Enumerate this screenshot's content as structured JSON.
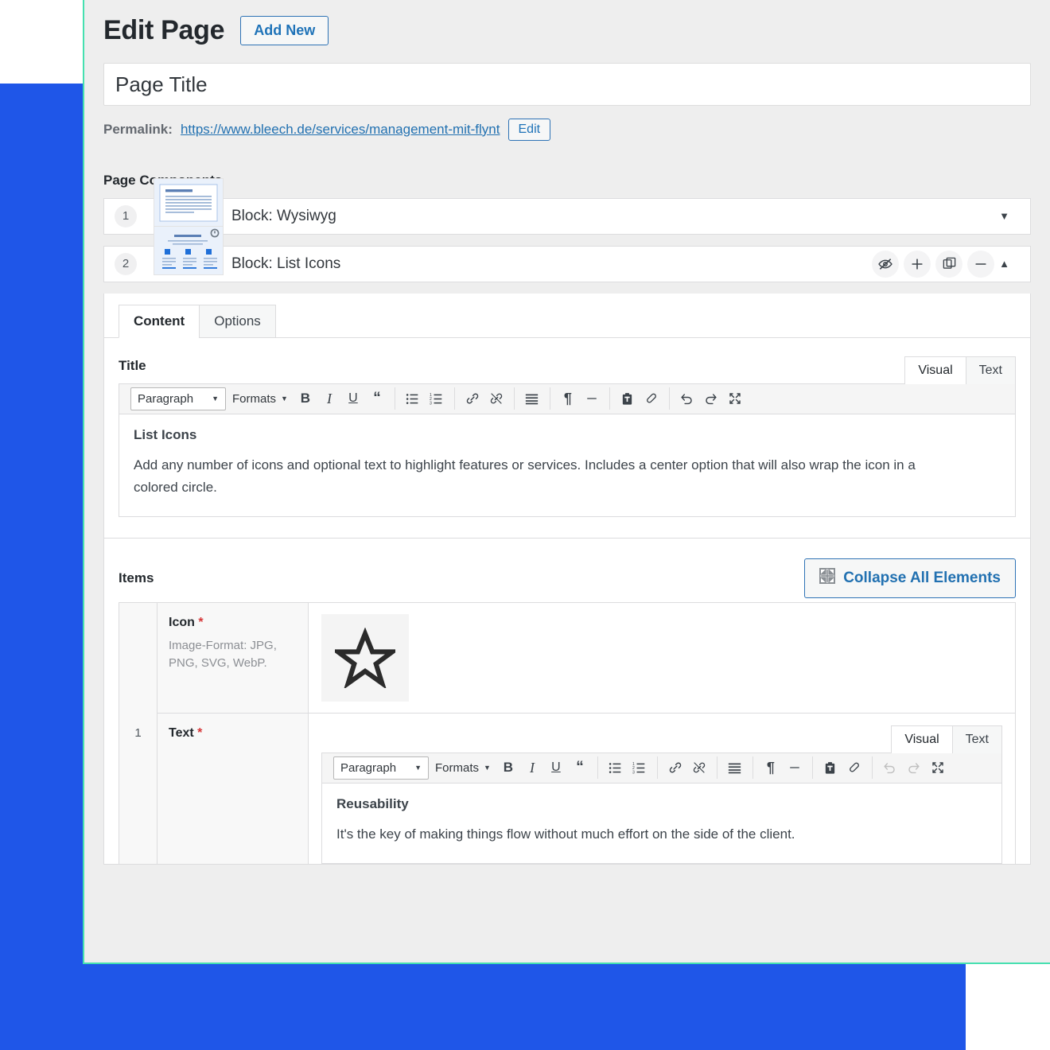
{
  "colors": {
    "accent_blue": "#1f56e8",
    "frame_border_teal": "#45e0b0",
    "link_blue": "#2271b1",
    "required_red": "#d63638"
  },
  "header": {
    "title": "Edit Page",
    "add_new_label": "Add New"
  },
  "title_field": {
    "value": "Page Title"
  },
  "permalink": {
    "label": "Permalink:",
    "url": "https://www.bleech.de/services/management-mit-flynt",
    "edit_label": "Edit"
  },
  "components": {
    "heading": "Page Components",
    "blocks": [
      {
        "number": "1",
        "label": "Block: Wysiwyg",
        "thumb": "wysiwyg-thumbnail",
        "expanded": false,
        "caret": "▼"
      },
      {
        "number": "2",
        "label": "Block: List Icons",
        "thumb": "list-icons-thumbnail",
        "expanded": true,
        "caret": "▲",
        "actions": [
          "hide-eye-icon",
          "add-icon",
          "duplicate-icon",
          "remove-icon",
          "collapse-caret-icon"
        ]
      }
    ]
  },
  "block_panel": {
    "tabs": [
      {
        "label": "Content",
        "active": true
      },
      {
        "label": "Options",
        "active": false
      }
    ],
    "title_field": {
      "label": "Title",
      "editor_modes": [
        {
          "label": "Visual",
          "active": true
        },
        {
          "label": "Text",
          "active": false
        }
      ],
      "toolbar": {
        "format_select": "Paragraph",
        "formats_label": "Formats",
        "buttons": [
          "bold-icon",
          "italic-icon",
          "underline-icon",
          "blockquote-icon",
          "bullet-list-icon",
          "numbered-list-icon",
          "insert-link-icon",
          "remove-link-icon",
          "align-icon",
          "pilcrow-icon",
          "horizontal-rule-icon",
          "paste-as-text-icon",
          "clear-formatting-icon",
          "undo-icon",
          "redo-icon",
          "fullscreen-icon"
        ]
      },
      "content_title": "List Icons",
      "content_paragraph": "Add any number of icons and optional text to highlight features or services. Includes a center option that will also wrap the icon in a colored circle."
    },
    "items": {
      "label": "Items",
      "collapse_all_label": "Collapse All Elements",
      "collapse_all_icon": "collapse-elements-icon",
      "rows": [
        {
          "index": "1",
          "icon_row": {
            "label": "Icon",
            "required_mark": "*",
            "description": "Image-Format: JPG, PNG, SVG, WebP.",
            "preview_icon": "star-icon"
          },
          "text_row": {
            "label": "Text",
            "required_mark": "*",
            "editor_modes": [
              {
                "label": "Visual",
                "active": true
              },
              {
                "label": "Text",
                "active": false
              }
            ],
            "toolbar": {
              "format_select": "Paragraph",
              "formats_label": "Formats"
            },
            "content_title": "Reusability",
            "content_paragraph": "It's the key of making things flow without much effort on the side of the client."
          }
        }
      ]
    }
  }
}
